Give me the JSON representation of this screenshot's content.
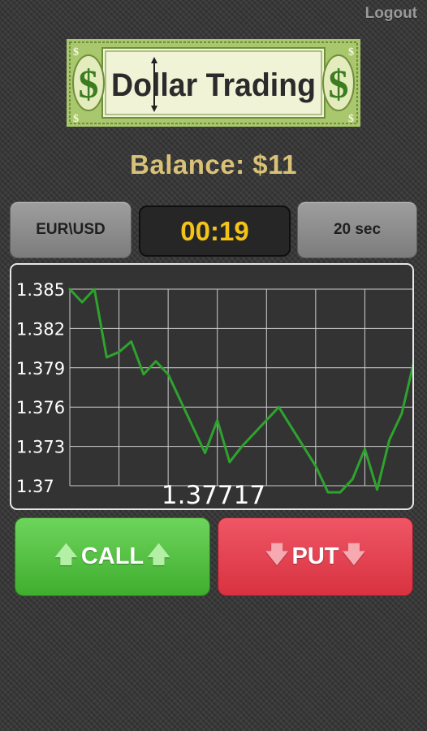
{
  "header": {
    "logout_label": "Logout"
  },
  "logo": {
    "text": "Dollar Trading",
    "symbol": "$"
  },
  "balance": {
    "text": "Balance: $11"
  },
  "controls": {
    "pair_label": "EUR\\USD",
    "timer": "00:19",
    "duration_label": "20 sec"
  },
  "chart_data": {
    "type": "line",
    "y_ticks": [
      "1.385",
      "1.382",
      "1.379",
      "1.376",
      "1.373",
      "1.37"
    ],
    "ylim": [
      1.37,
      1.385
    ],
    "grid": true,
    "x": [
      0,
      1,
      2,
      3,
      4,
      5,
      6,
      7,
      8,
      9,
      10,
      11,
      12,
      13,
      14,
      15,
      16,
      17,
      18,
      19,
      20,
      21,
      22,
      23,
      24,
      25,
      26,
      27,
      28
    ],
    "series": [
      {
        "color": "#2ea32e",
        "values": [
          1.385,
          1.384,
          1.385,
          1.3798,
          1.3802,
          1.381,
          1.3785,
          1.3795,
          1.3785,
          1.3765,
          1.3745,
          1.3725,
          1.375,
          1.3718,
          1.373,
          1.374,
          1.375,
          1.376,
          1.3745,
          1.373,
          1.3715,
          1.3695,
          1.3695,
          1.3705,
          1.3728,
          1.3697,
          1.3735,
          1.3755,
          1.3795
        ]
      }
    ],
    "current_price": "1.37717"
  },
  "actions": {
    "call_label": "CALL",
    "put_label": "PUT",
    "call_color": "#4fc23c",
    "put_color": "#e33d4b"
  }
}
